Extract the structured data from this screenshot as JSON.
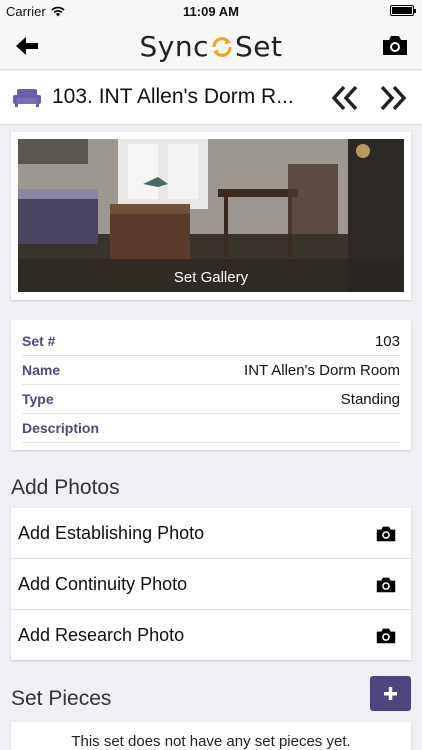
{
  "status_bar": {
    "carrier": "Carrier",
    "time": "11:09 AM"
  },
  "nav": {
    "logo_text_left": "Sync",
    "logo_text_right": "Set"
  },
  "set_header": {
    "title": "103. INT Allen's Dorm R..."
  },
  "gallery": {
    "label": "Set Gallery"
  },
  "details": [
    {
      "label": "Set #",
      "value": "103"
    },
    {
      "label": "Name",
      "value": "INT Allen's Dorm Room"
    },
    {
      "label": "Type",
      "value": "Standing"
    },
    {
      "label": "Description",
      "value": ""
    }
  ],
  "add_photos": {
    "title": "Add Photos",
    "items": [
      "Add Establishing Photo",
      "Add Continuity Photo",
      "Add Research Photo"
    ]
  },
  "set_pieces": {
    "title": "Set Pieces",
    "empty_text": "This set does not have any set pieces yet."
  },
  "colors": {
    "accent": "#4f4680",
    "logo_ring": "#f0a818"
  }
}
